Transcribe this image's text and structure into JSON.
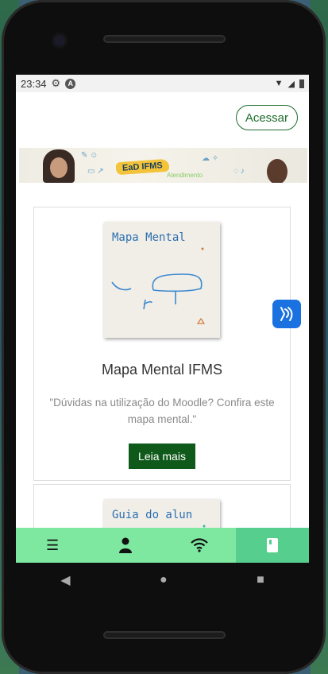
{
  "status": {
    "time": "23:34",
    "gear_icon": "gear-icon",
    "android_icon": "A"
  },
  "header": {
    "login_label": "Acessar"
  },
  "banner": {
    "tag": "EaD IFMS",
    "subtext": "Atendimento"
  },
  "cards": [
    {
      "thumb_title": "Mapa Mental",
      "title": "Mapa Mental IFMS",
      "desc": "\"Dúvidas na utilização do Moodle? Confira este mapa mental.\"",
      "button": "Leia mais"
    },
    {
      "thumb_title": "Guia do alun"
    }
  ],
  "nav": {
    "items": [
      "list-icon",
      "person-icon",
      "wifi-icon",
      "book-icon"
    ],
    "active": 3
  },
  "colors": {
    "accent": "#0f5a1a",
    "nav_bg": "#7ee8a0",
    "nav_active": "#56cf8e",
    "vlibras": "#1a72e0"
  }
}
